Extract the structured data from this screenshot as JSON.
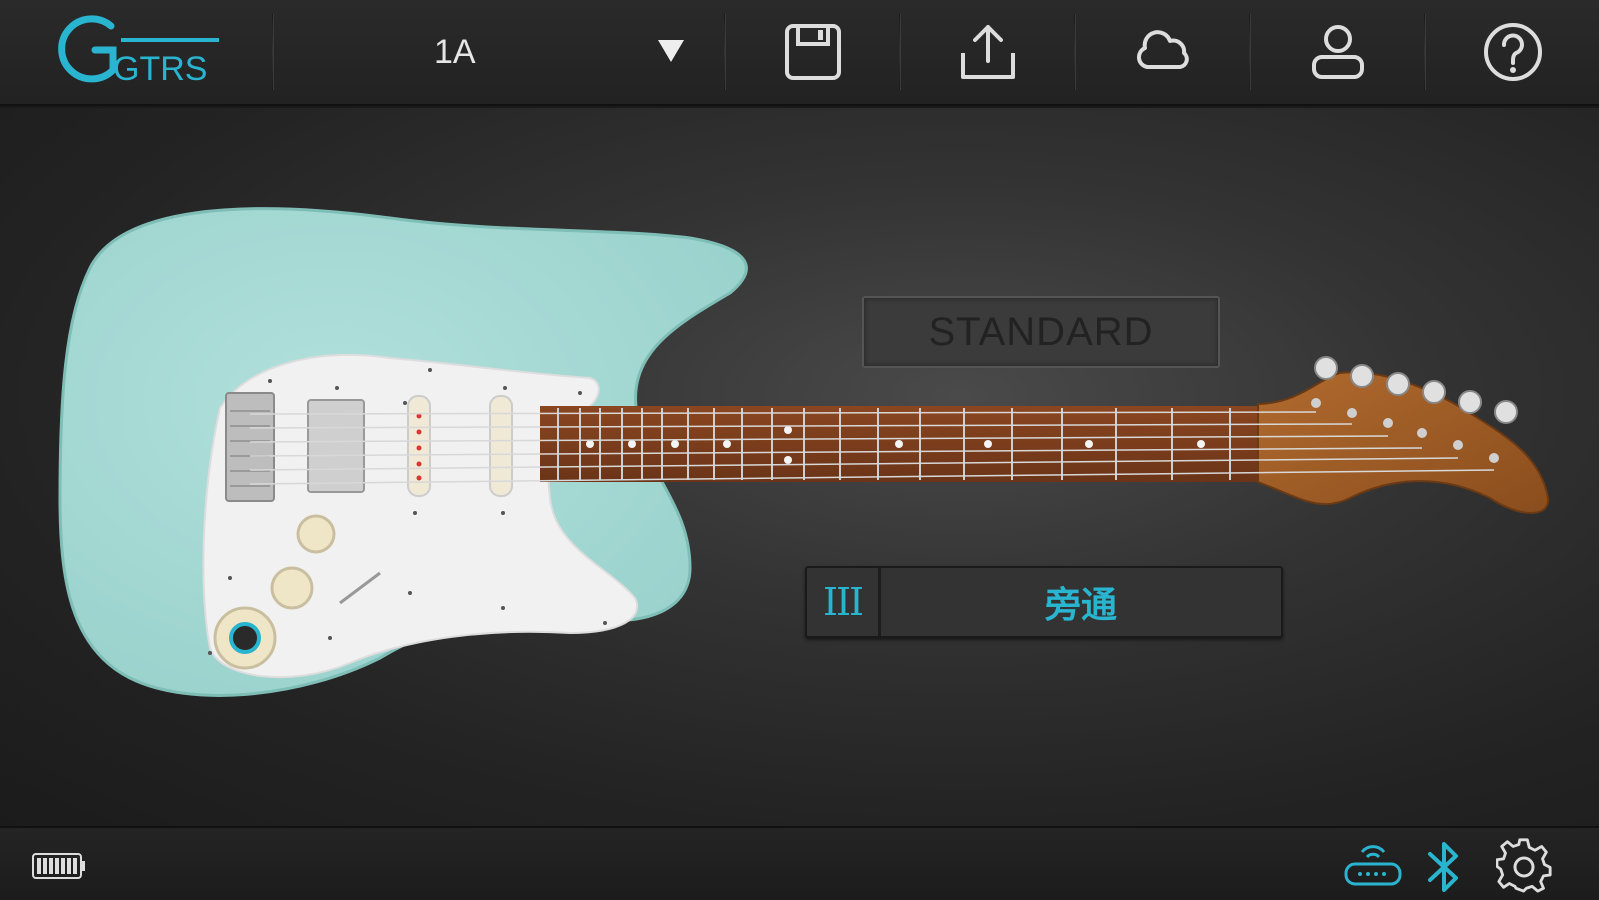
{
  "app": {
    "logo_text": "GTRS"
  },
  "header": {
    "preset_name": "1A",
    "buttons": [
      "save",
      "export",
      "cloud",
      "account",
      "help"
    ]
  },
  "main": {
    "tuning_label": "STANDARD",
    "mode": {
      "icon_text": "III",
      "label": "旁通"
    }
  },
  "footer": {
    "icons": [
      "battery-icon",
      "device-connection-icon",
      "bluetooth-icon",
      "settings-icon"
    ]
  },
  "colors": {
    "accent": "#29b4d0",
    "guitar_body": "#a8d9d4",
    "pickguard": "#f2f2f2",
    "fretboard": "#7a3d1c",
    "headstock": "#9c5a24"
  }
}
